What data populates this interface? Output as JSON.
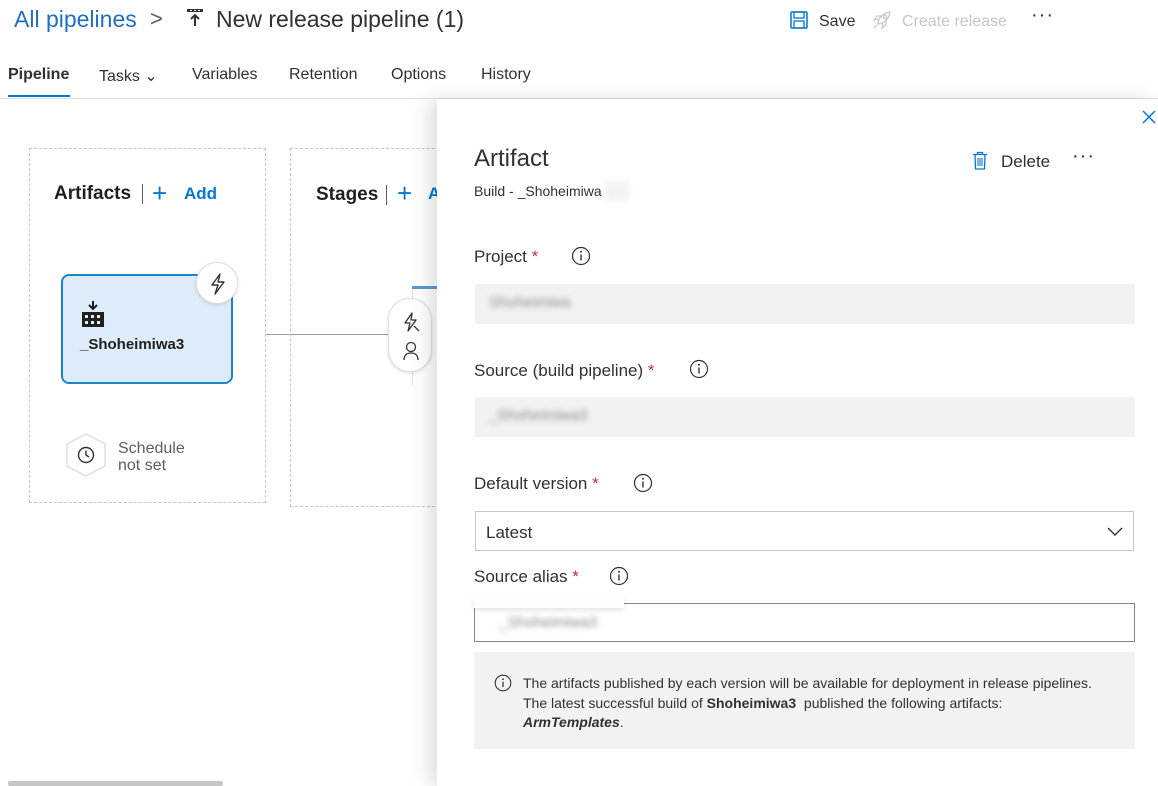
{
  "header": {
    "breadcrumb_root": "All pipelines",
    "breadcrumb_sep": ">",
    "pipeline_name": "New release pipeline (1)",
    "save_label": "Save",
    "create_release_label": "Create release",
    "more": "···"
  },
  "tabs": [
    {
      "label": "Pipeline",
      "active": true
    },
    {
      "label": "Tasks ⌄",
      "active": false
    },
    {
      "label": "Variables",
      "active": false
    },
    {
      "label": "Retention",
      "active": false
    },
    {
      "label": "Options",
      "active": false
    },
    {
      "label": "History",
      "active": false
    }
  ],
  "canvas": {
    "artifacts_title": "Artifacts",
    "artifacts_add": "Add",
    "stages_title": "Stages",
    "stages_add": "A",
    "artifact_card_name": "_Shoheimiwa3",
    "schedule_line1": "Schedule",
    "schedule_line2": "not set"
  },
  "panel": {
    "title": "Artifact",
    "subtitle": "Build - _Shoheimiwa",
    "delete_label": "Delete",
    "more": "···",
    "project_label": "Project",
    "project_value": "Shoheimiwa",
    "source_label": "Source (build pipeline)",
    "source_value": "_Shoheimiwa3",
    "default_version_label": "Default version",
    "default_version_value": "Latest",
    "source_alias_label": "Source alias",
    "source_alias_value": "_Shoheimiwa3",
    "required_marker": "*",
    "info_line1": "The artifacts published by each version will be available for deployment in release pipelines.",
    "info_line2_prefix": "The latest successful build of",
    "info_build_name": "Shoheimiwa3",
    "info_line2_suffix": "published the following artifacts:",
    "info_artifact_name": "ArmTemplates",
    "info_period": "."
  },
  "colors": {
    "accent": "#0078d4",
    "required": "#c4314b",
    "artifact_card_bg": "#deecf9",
    "artifact_card_border": "#1a86c8"
  }
}
